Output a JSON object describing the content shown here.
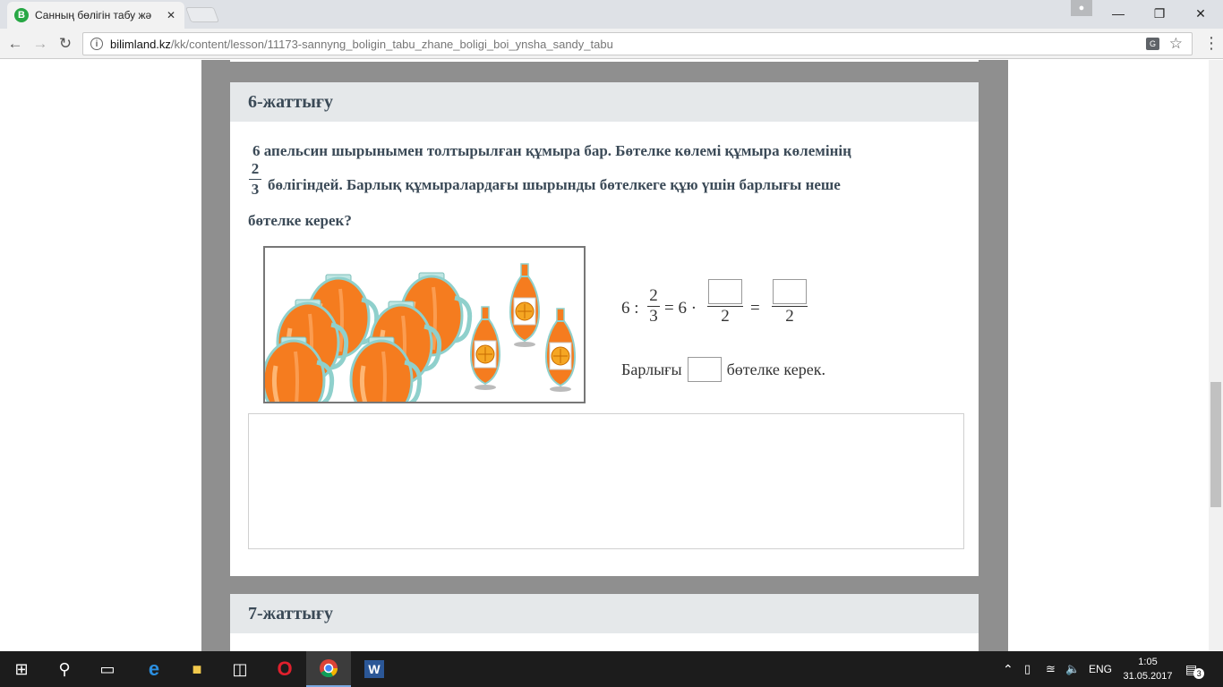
{
  "browser": {
    "tab_title": "Санның бөлігін табу жә",
    "tab_favicon_letter": "B",
    "url_domain": "bilimland.kz",
    "url_path": "/kk/content/lesson/11173-sannyng_boligin_tabu_zhane_boligi_boi_ynsha_sandy_tabu"
  },
  "exercise6": {
    "title": "6-жаттығу",
    "q_line1": "6 апельсин шырынымен толтырылған құмыра бар. Бөтелке көлемі құмыра көлемінің",
    "frac_num": "2",
    "frac_den": "3",
    "q_line2": "бөлігіндей. Барлық құмыралардағы шырынды бөтелкеге құю үшін барлығы неше",
    "q_line3": "бөтелке керек?",
    "equation": {
      "lhs": "6 :",
      "f1_num": "2",
      "f1_den": "3",
      "mid": "= 6 ·",
      "f2_den": "2",
      "eq": "=",
      "f3_den": "2"
    },
    "answer_prefix": "Барлығы",
    "answer_suffix": "бөтелке керек."
  },
  "exercise7": {
    "title": "7-жаттығу"
  },
  "taskbar": {
    "lang": "ENG",
    "time": "1:05",
    "date": "31.05.2017",
    "notif_count": "3"
  },
  "colors": {
    "juice": "#f57c1f",
    "glass": "#8fd0cc",
    "header_bg": "#e5e8ea",
    "title_text": "#3b4a57"
  }
}
